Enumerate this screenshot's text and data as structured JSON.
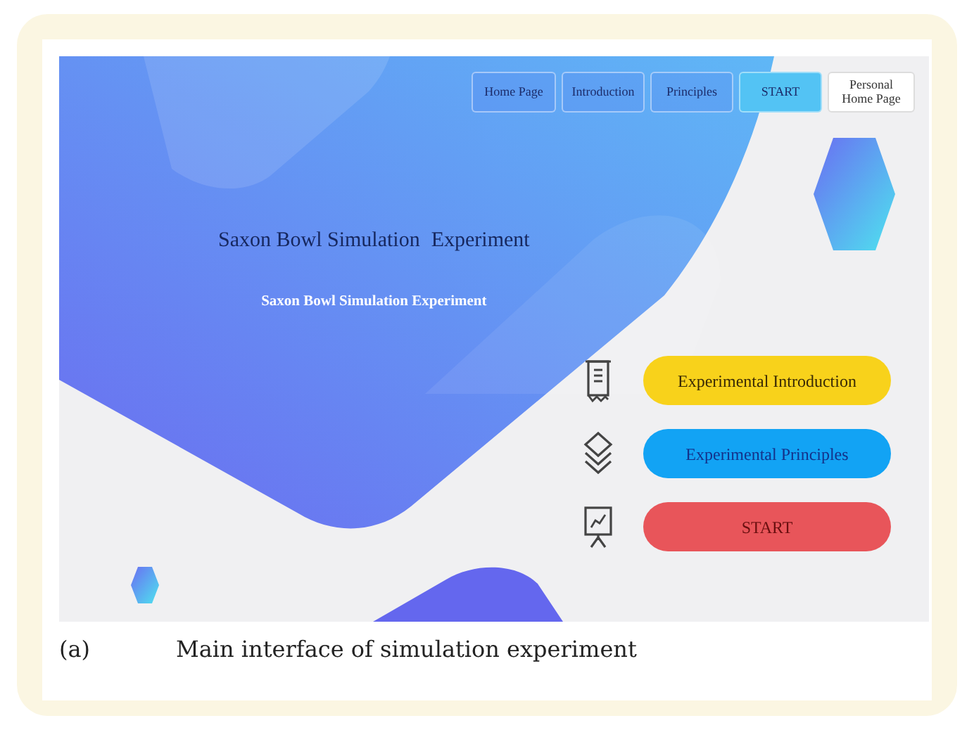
{
  "figure": {
    "screen": {
      "nav": [
        {
          "kind": "link",
          "label": "Home Page",
          "selected": false
        },
        {
          "kind": "link",
          "label": "Introduction",
          "selected": false
        },
        {
          "kind": "link",
          "label": "Principles",
          "selected": false
        },
        {
          "kind": "link",
          "label": "START",
          "selected": true
        },
        {
          "kind": "profile",
          "label": "Personal Home Page",
          "selected": false
        }
      ],
      "title_parts": [
        "Saxon Bowl Simulation",
        "Experiment"
      ],
      "subtitle": "Saxon Bowl Simulation Experiment",
      "actions": [
        {
          "kind": "document",
          "label": "Experimental Introduction",
          "color": "#f8d21b"
        },
        {
          "kind": "layers",
          "label": "Experimental Principles",
          "color": "#12a3f4"
        },
        {
          "kind": "board",
          "label": "START",
          "color": "#e8555a"
        }
      ]
    },
    "caption": {
      "label": "(a)",
      "text": "Main interface of simulation experiment"
    }
  }
}
